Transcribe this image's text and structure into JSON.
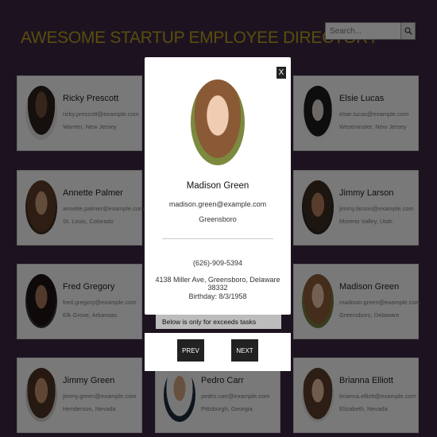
{
  "header": {
    "title": "AWESOME STARTUP EMPLOYEE DIRECTORY",
    "search_placeholder": "Search..."
  },
  "employees": [
    {
      "name": "Ricky Prescott",
      "email": "ricky.prescott@example.com",
      "location": "Warren, New Jersey"
    },
    {
      "name": "Elsie Lucas",
      "email": "elsie.lucas@example.com",
      "location": "Westminster, New Jersey"
    },
    {
      "name": "Annette Palmer",
      "email": "annette.palmer@example.com",
      "location": "St. Louis, Colorado"
    },
    {
      "name": "Jimmy Larson",
      "email": "jimmy.larson@example.com",
      "location": "Moreno Valley, Utah"
    },
    {
      "name": "Fred Gregory",
      "email": "fred.gregory@example.com",
      "location": "Elk Grove, Arkansas"
    },
    {
      "name": "Madison Green",
      "email": "madison.green@example.com",
      "location": "Greensboro, Delaware"
    },
    {
      "name": "Jimmy Green",
      "email": "jimmy.green@example.com",
      "location": "Henderson, Nevada"
    },
    {
      "name": "Pedro Carr",
      "email": "pedro.carr@example.com",
      "location": "Pittsburgh, Georgia"
    },
    {
      "name": "Brianna Elliott",
      "email": "brianna.elliott@example.com",
      "location": "Elizabeth, Nevada"
    }
  ],
  "modal": {
    "close_label": "X",
    "name": "Madison Green",
    "email": "madison.green@example.com",
    "city": "Greensboro",
    "phone": "(626)-909-5394",
    "address": "4138 Miller Ave, Greensboro, Delaware 38332",
    "birthday": "Birthday: 8/3/1958"
  },
  "banner_text": "Below is only for exceeds tasks",
  "nav": {
    "prev_label": "PREV",
    "next_label": "NEXT"
  }
}
